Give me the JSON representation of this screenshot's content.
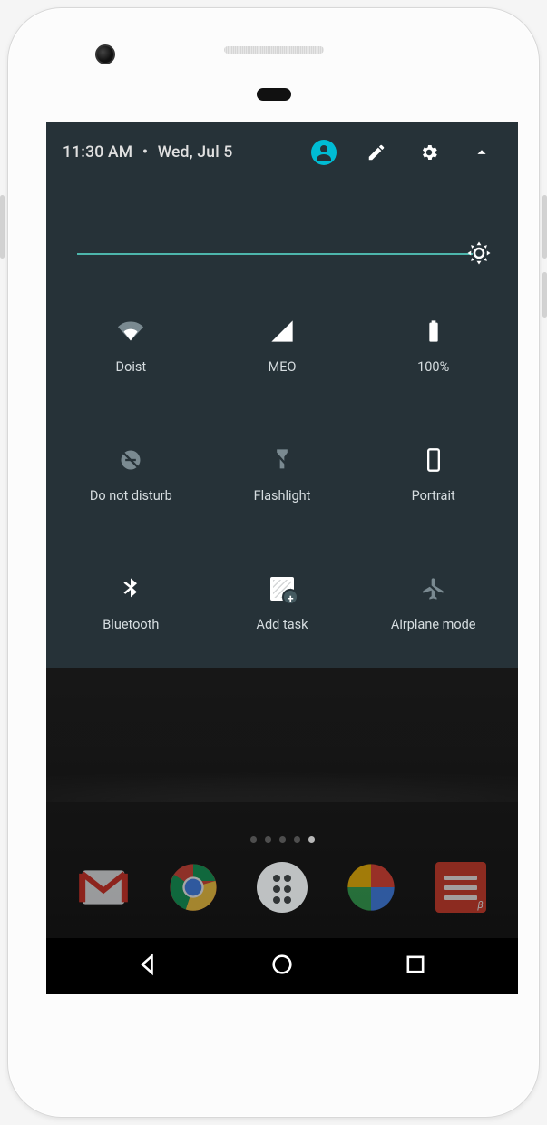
{
  "header": {
    "time": "11:30 AM",
    "separator": "•",
    "date": "Wed, Jul 5"
  },
  "brightness": {
    "value": 100
  },
  "tiles": {
    "wifi": {
      "label": "Doist"
    },
    "signal": {
      "label": "MEO"
    },
    "battery": {
      "label": "100%"
    },
    "dnd": {
      "label": "Do not disturb"
    },
    "flashlight": {
      "label": "Flashlight"
    },
    "portrait": {
      "label": "Portrait"
    },
    "bluetooth": {
      "label": "Bluetooth"
    },
    "addtask": {
      "label": "Add task"
    },
    "airplane": {
      "label": "Airplane mode"
    }
  },
  "dock": {
    "apps": [
      "Gmail",
      "Chrome",
      "Apps",
      "Photos",
      "Todoist"
    ],
    "todoist_badge": "β"
  }
}
